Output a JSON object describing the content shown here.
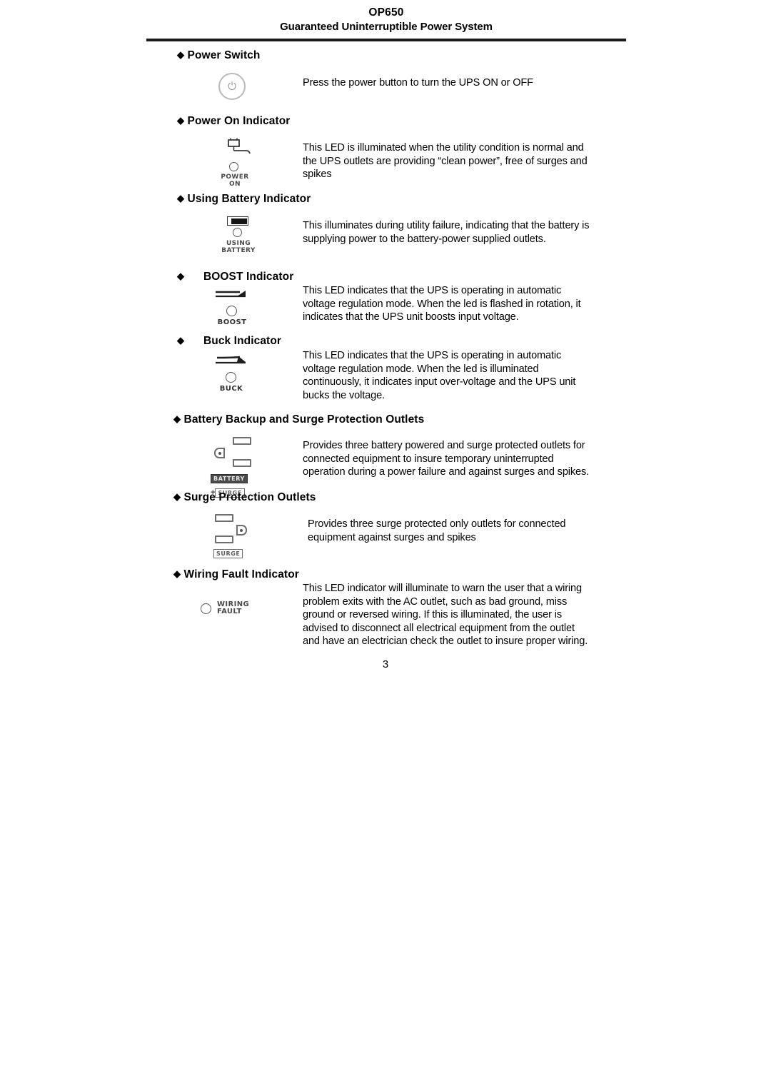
{
  "document": {
    "header": {
      "title": "OP650",
      "subtitle": "Guaranteed Uninterruptible Power System"
    },
    "page_number": "3",
    "bullet_glyph": "◆",
    "sections": [
      {
        "id": "power-switch",
        "heading": "Power Switch",
        "icon": {
          "type": "power-button-icon",
          "symbol": "⏻",
          "labels": []
        },
        "lines": [
          "Press the power button to turn the UPS ON or OFF"
        ]
      },
      {
        "id": "power-on-indicator",
        "heading": "Power On Indicator",
        "icon": {
          "type": "power-on-led-icon",
          "labels": [
            "POWER",
            "ON"
          ]
        },
        "lines": [
          "This LED is illuminated when the utility condition is normal and",
          "the UPS outlets are providing “clean power”, free of surges and",
          "spikes"
        ]
      },
      {
        "id": "using-battery-indicator",
        "heading": "Using Battery Indicator",
        "icon": {
          "type": "battery-led-icon",
          "labels": [
            "USING",
            "BATTERY"
          ]
        },
        "lines": [
          "This illuminates during utility failure, indicating that the battery is",
          "supplying power to the battery-power supplied outlets."
        ]
      },
      {
        "id": "boost-indicator",
        "heading": "BOOST Indicator",
        "icon": {
          "type": "boost-led-icon",
          "labels": [
            "BOOST"
          ]
        },
        "lines": [
          "This LED indicates that the UPS is operating in automatic",
          "voltage regulation mode. When the led is flashed in rotation, it",
          "indicates that the UPS unit boosts input voltage."
        ]
      },
      {
        "id": "buck-indicator",
        "heading": "Buck Indicator",
        "icon": {
          "type": "buck-led-icon",
          "labels": [
            "BUCK"
          ]
        },
        "lines": [
          "This LED indicates that the UPS is operating in automatic",
          "voltage regulation mode. When the led is illuminated",
          "continuously, it indicates input over-voltage and the UPS unit",
          "bucks the voltage."
        ]
      },
      {
        "id": "battery-backup-surge-outlets",
        "heading": "Battery Backup and Surge Protection Outlets",
        "icon": {
          "type": "battery-surge-outlet-icon",
          "labels": [
            "BATTERY",
            "+",
            "SURGE"
          ]
        },
        "lines": [
          "Provides three battery powered and surge protected outlets for",
          "connected equipment to insure temporary uninterrupted",
          "operation during a power failure and against surges and spikes."
        ]
      },
      {
        "id": "surge-protection-outlets",
        "heading": "Surge Protection Outlets",
        "icon": {
          "type": "surge-outlet-icon",
          "labels": [
            "SURGE"
          ]
        },
        "lines": [
          "Provides three surge protected only outlets for connected",
          "equipment against surges and spikes"
        ]
      },
      {
        "id": "wiring-fault-indicator",
        "heading": "Wiring Fault Indicator",
        "icon": {
          "type": "wiring-fault-led-icon",
          "labels": [
            "WIRING",
            "FAULT"
          ]
        },
        "lines": [
          "This LED indicator will illuminate to warn the user that a wiring",
          "problem exits with the AC outlet, such as bad ground, miss",
          "ground or reversed wiring.   If this is illuminated, the user is",
          "advised to disconnect all electrical equipment from the outlet",
          "and have an electrician check the outlet to insure proper wiring."
        ]
      }
    ]
  }
}
